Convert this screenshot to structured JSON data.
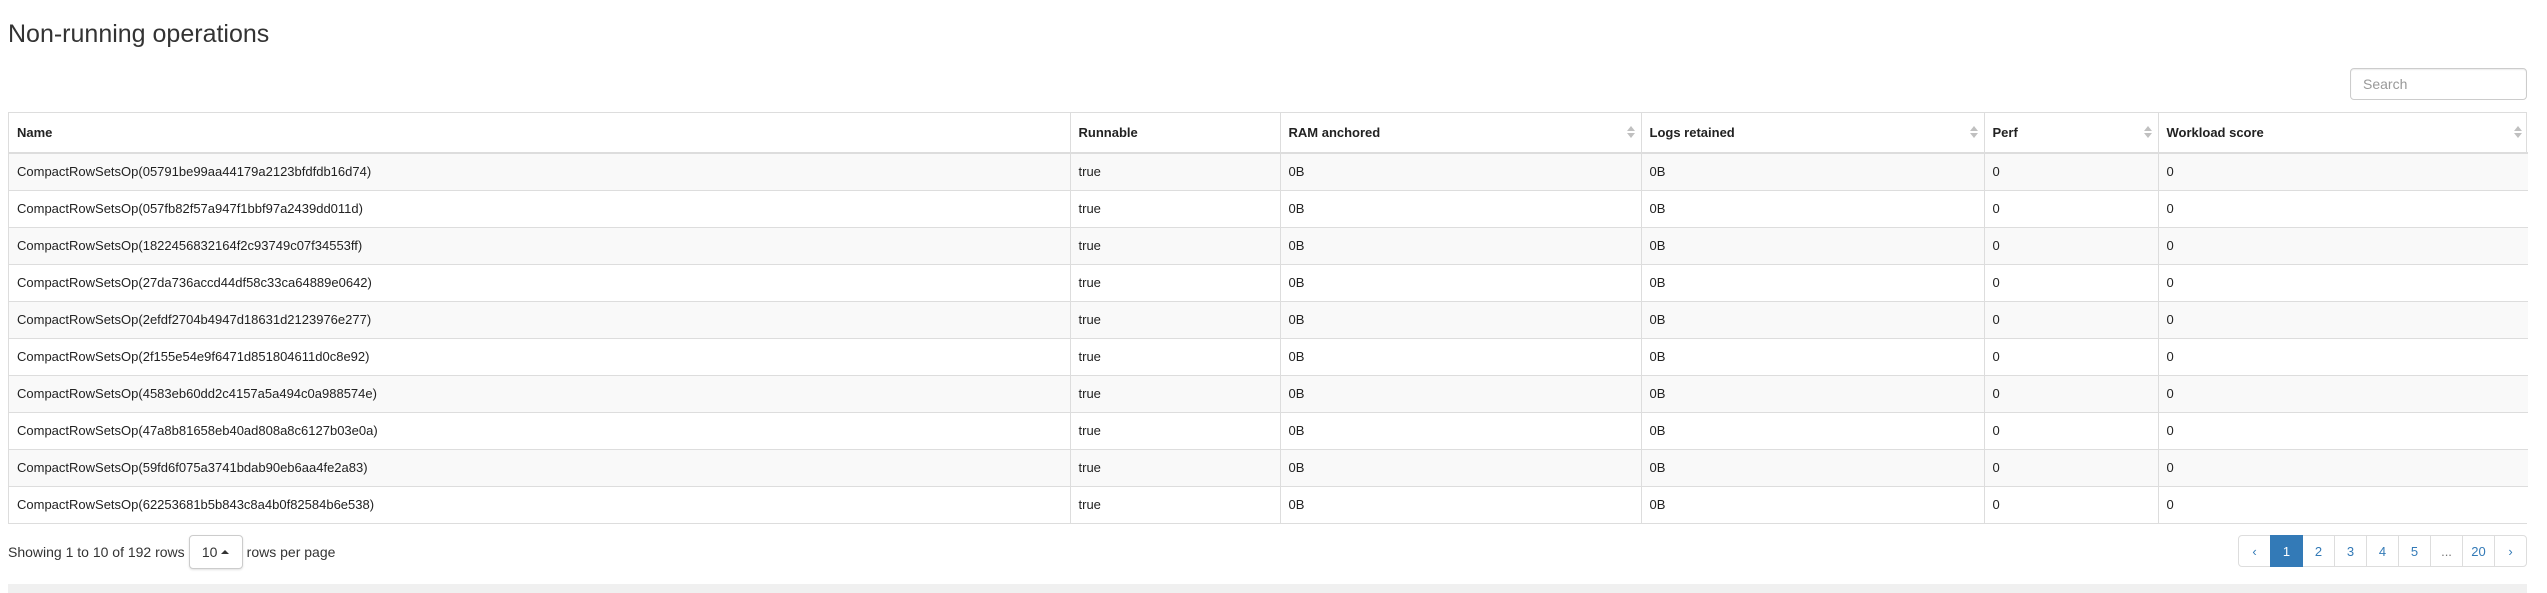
{
  "page_title": "Non-running operations",
  "search": {
    "placeholder": "Search"
  },
  "table": {
    "columns": [
      {
        "label": "Name",
        "sortable": false
      },
      {
        "label": "Runnable",
        "sortable": false
      },
      {
        "label": "RAM anchored",
        "sortable": true
      },
      {
        "label": "Logs retained",
        "sortable": true
      },
      {
        "label": "Perf",
        "sortable": true
      },
      {
        "label": "Workload score",
        "sortable": true
      }
    ],
    "rows": [
      [
        "CompactRowSetsOp(05791be99aa44179a2123bfdfdb16d74)",
        "true",
        "0B",
        "0B",
        "0",
        "0"
      ],
      [
        "CompactRowSetsOp(057fb82f57a947f1bbf97a2439dd011d)",
        "true",
        "0B",
        "0B",
        "0",
        "0"
      ],
      [
        "CompactRowSetsOp(1822456832164f2c93749c07f34553ff)",
        "true",
        "0B",
        "0B",
        "0",
        "0"
      ],
      [
        "CompactRowSetsOp(27da736accd44df58c33ca64889e0642)",
        "true",
        "0B",
        "0B",
        "0",
        "0"
      ],
      [
        "CompactRowSetsOp(2efdf2704b4947d18631d2123976e277)",
        "true",
        "0B",
        "0B",
        "0",
        "0"
      ],
      [
        "CompactRowSetsOp(2f155e54e9f6471d851804611d0c8e92)",
        "true",
        "0B",
        "0B",
        "0",
        "0"
      ],
      [
        "CompactRowSetsOp(4583eb60dd2c4157a5a494c0a988574e)",
        "true",
        "0B",
        "0B",
        "0",
        "0"
      ],
      [
        "CompactRowSetsOp(47a8b81658eb40ad808a8c6127b03e0a)",
        "true",
        "0B",
        "0B",
        "0",
        "0"
      ],
      [
        "CompactRowSetsOp(59fd6f075a3741bdab90eb6aa4fe2a83)",
        "true",
        "0B",
        "0B",
        "0",
        "0"
      ],
      [
        "CompactRowSetsOp(62253681b5b843c8a4b0f82584b6e538)",
        "true",
        "0B",
        "0B",
        "0",
        "0"
      ]
    ]
  },
  "footer": {
    "showing_text": "Showing 1 to 10 of 192 rows",
    "page_size": "10",
    "rows_per_page_text": "rows per page"
  },
  "pagination": {
    "prev": "‹",
    "next": "›",
    "pages": [
      "1",
      "2",
      "3",
      "4",
      "5",
      "...",
      "20"
    ],
    "active": "1"
  },
  "colors": {
    "accent": "#337ab7",
    "stripe": "#f9f9f9",
    "border": "#dddddd"
  }
}
